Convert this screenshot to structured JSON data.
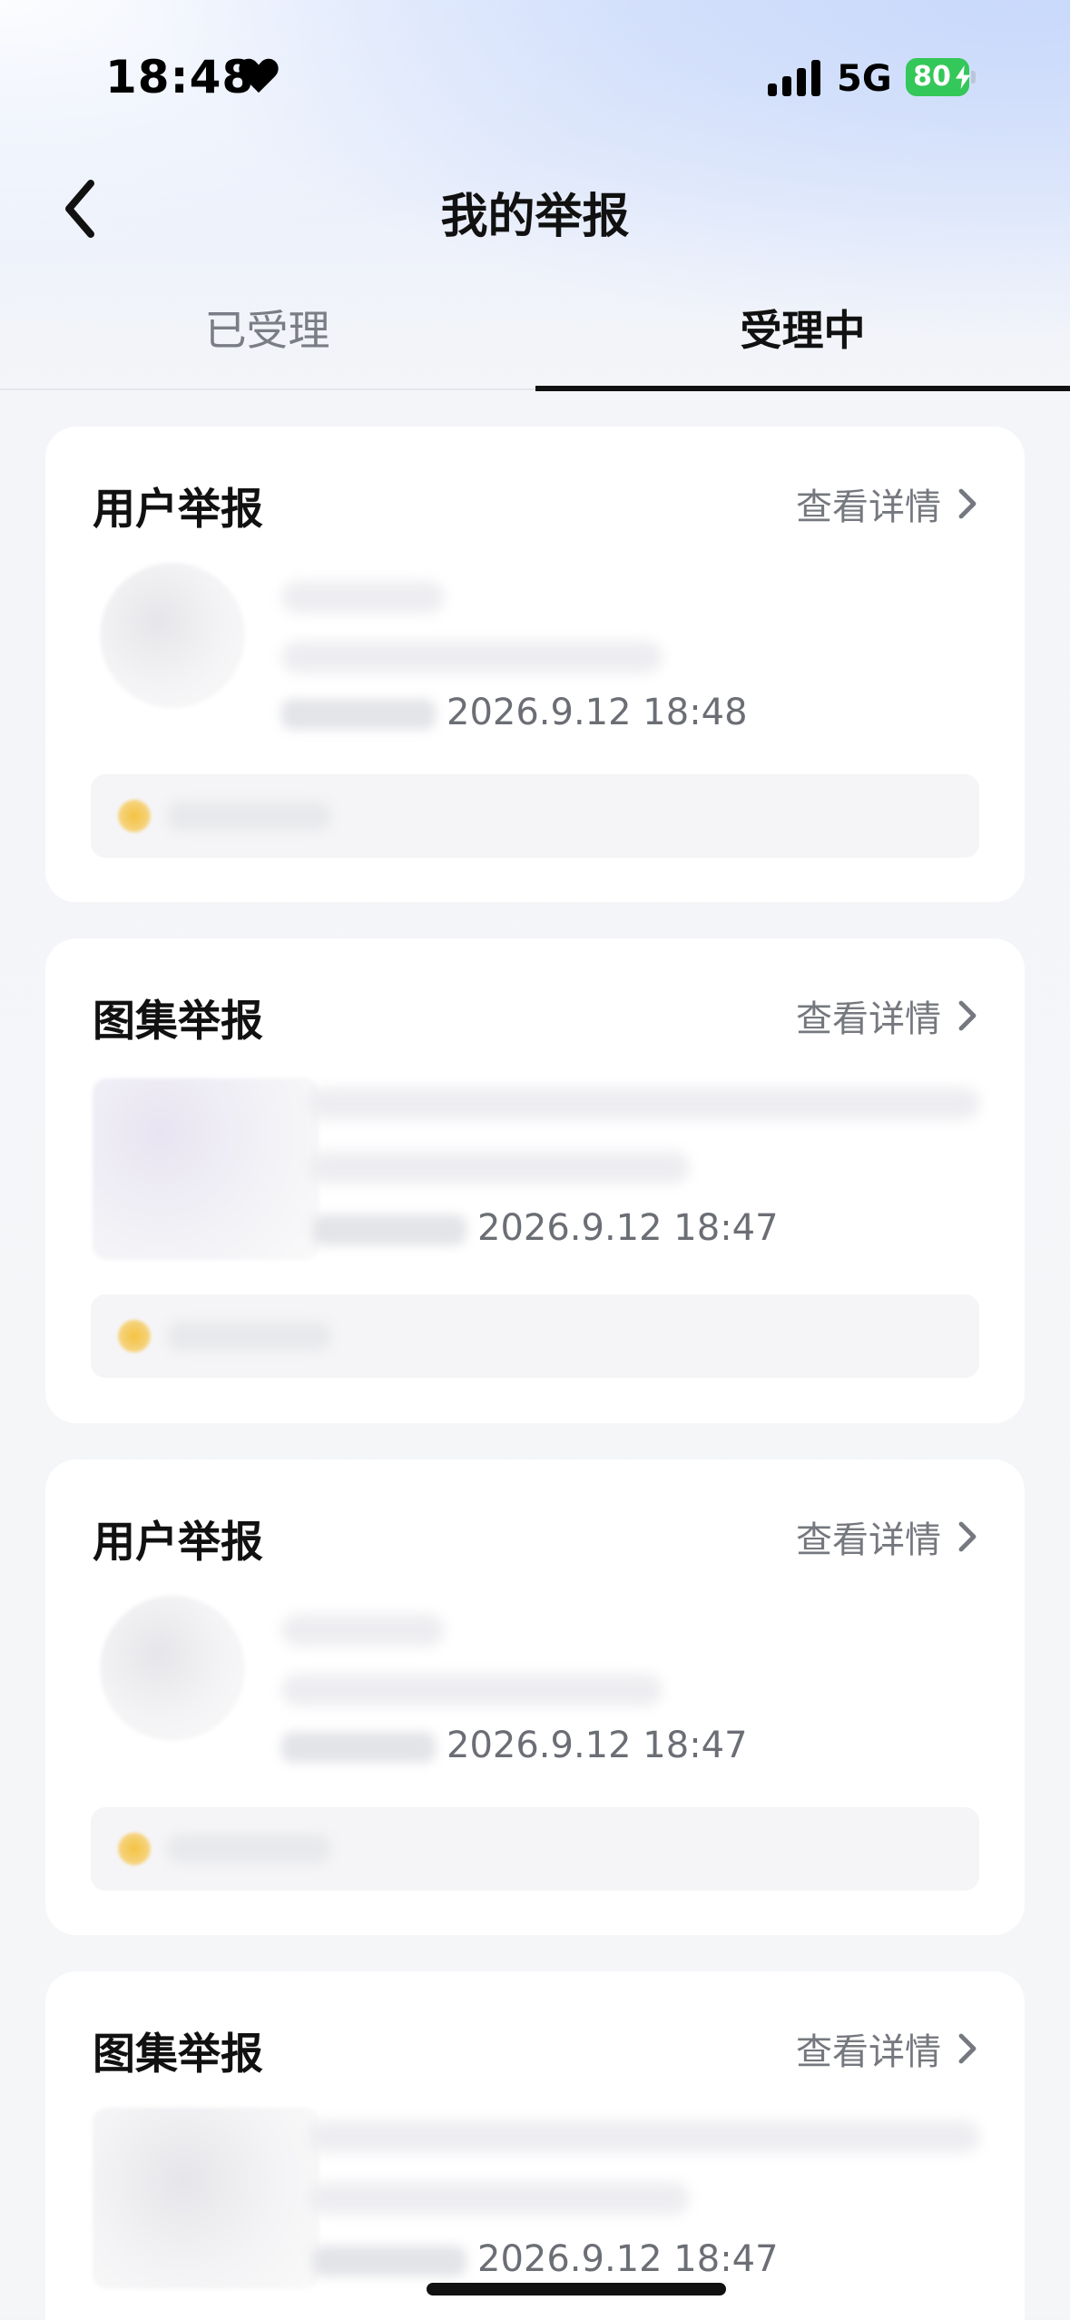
{
  "status_bar": {
    "time": "18:48",
    "network": "5G",
    "battery": "80"
  },
  "nav": {
    "title": "我的举报"
  },
  "tabs": [
    {
      "label": "已受理",
      "active": false
    },
    {
      "label": "受理中",
      "active": true
    }
  ],
  "details_label": "查看详情",
  "cards": [
    {
      "title": "用户举报",
      "time": "2026.9.12 18:48"
    },
    {
      "title": "图集举报",
      "time": "2026.9.12 18:47"
    },
    {
      "title": "用户举报",
      "time": "2026.9.12 18:47"
    },
    {
      "title": "图集举报",
      "time": "2026.9.12 18:47"
    }
  ],
  "colors": {
    "accent": "#111111",
    "battery": "#34c759",
    "status_dot": "#f5c242"
  }
}
